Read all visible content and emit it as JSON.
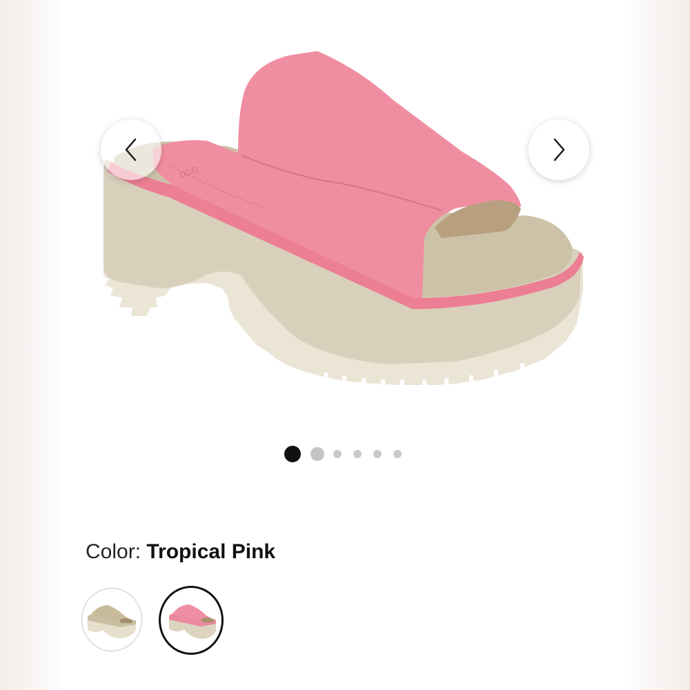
{
  "product": {
    "image_alt": "Pink suede platform slide sandal",
    "brand_mark": "UGG",
    "colors": {
      "upper": "#f08ea1",
      "sole": "#d9d0bc",
      "outsole": "#ebe5d6",
      "binding": "#ec7f93"
    }
  },
  "carousel": {
    "prev_icon": "chevron-left-icon",
    "next_icon": "chevron-right-icon",
    "active_index": 0,
    "total": 6
  },
  "color_selector": {
    "label": "Color:",
    "selected_value": "Tropical Pink",
    "swatches": [
      {
        "name": "Sand",
        "selected": false
      },
      {
        "name": "Tropical Pink",
        "selected": true
      }
    ]
  }
}
